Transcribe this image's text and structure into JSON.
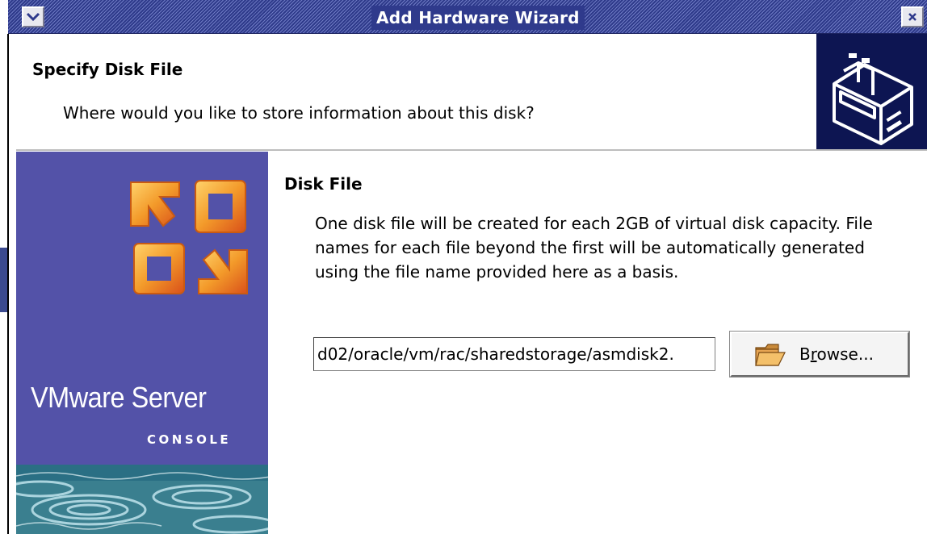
{
  "window": {
    "title": "Add Hardware Wizard"
  },
  "header": {
    "title": "Specify Disk File",
    "subtitle": "Where would you like to store information about this disk?",
    "icon": "hard-disk-icon"
  },
  "banner": {
    "brand_name": "VMware Server",
    "brand_sub": "CONSOLE",
    "logo": "vmware-logo-icon"
  },
  "content": {
    "section_title": "Disk File",
    "description": "One disk file will be created for each 2GB of virtual disk capacity. File names for each file beyond the first will be automatically generated using the file name provided here as a basis.",
    "path_value": "d02/oracle/vm/rac/sharedstorage/asmdisk2.",
    "browse_label_pre": "B",
    "browse_label_mnemonic": "r",
    "browse_label_post": "owse...",
    "browse_icon": "folder-icon"
  },
  "colors": {
    "titlebar": "#2f3a8c",
    "banner": "#5352a8",
    "header_icon_bg": "#0d1552",
    "logo_orange": "#f08a1e"
  }
}
